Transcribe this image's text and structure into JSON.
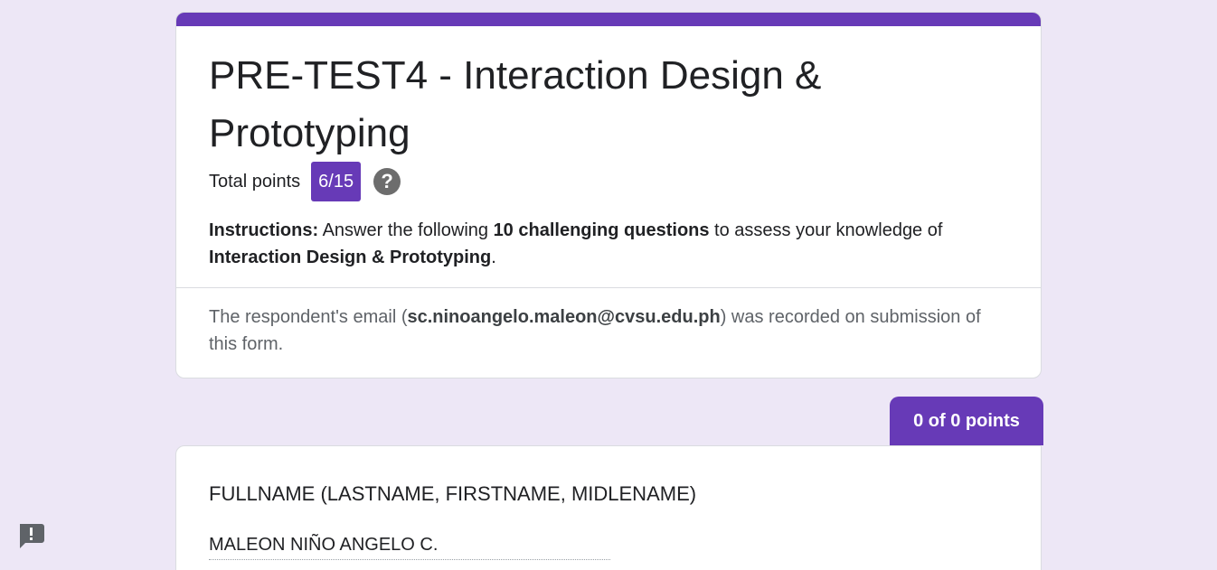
{
  "header": {
    "title": "PRE-TEST4 - Interaction Design & Prototyping",
    "total_points_label": "Total points",
    "score": "6/15",
    "help_icon": "help-circle-icon",
    "instructions": {
      "lead": "Instructions:",
      "text1": " Answer the following ",
      "bold1": "10 challenging questions",
      "text2": " to assess your knowledge of ",
      "bold2": "Interaction Design & Prototyping",
      "text3": "."
    },
    "email_note": {
      "prefix": "The respondent's email (",
      "email": "sc.ninoangelo.maleon@cvsu.edu.ph",
      "suffix": ") was recorded on submission of this form."
    }
  },
  "question": {
    "points": "0 of 0 points",
    "label": "FULLNAME (LASTNAME, FIRSTNAME, MIDLENAME)",
    "answer": "MALEON NIÑO ANGELO C."
  },
  "feedback": {
    "icon": "report-feedback-icon"
  },
  "colors": {
    "accent": "#673ab7",
    "background": "#ede7f6"
  }
}
